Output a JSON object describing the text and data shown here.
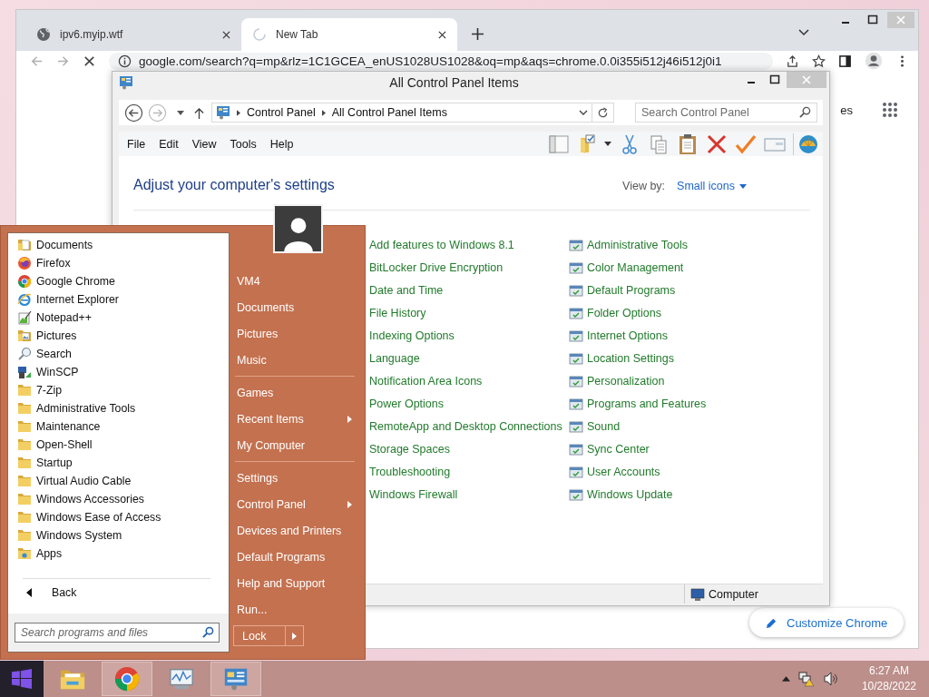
{
  "browser": {
    "tabs": [
      {
        "title": "ipv6.myip.wtf",
        "selected": false,
        "loading": false
      },
      {
        "title": "New Tab",
        "selected": true,
        "loading": true
      }
    ],
    "address": "google.com/search?q=mp&rlz=1C1GCEA_enUS1028US1028&oq=mp&aqs=chrome.0.0i355i512j46i512j0i1",
    "page_text": "es",
    "customize_button": "Customize Chrome"
  },
  "control_panel": {
    "title": "All Control Panel Items",
    "breadcrumb": [
      "Control Panel",
      "All Control Panel Items"
    ],
    "search_placeholder": "Search Control Panel",
    "menu": [
      "File",
      "Edit",
      "View",
      "Tools",
      "Help"
    ],
    "heading": "Adjust your computer's settings",
    "view_by_label": "View by:",
    "view_by_value": "Small icons",
    "left_items": [
      "Add features to Windows 8.1",
      "BitLocker Drive Encryption",
      "Date and Time",
      "File History",
      "Indexing Options",
      "Language",
      "Notification Area Icons",
      "Power Options",
      "RemoteApp and Desktop Connections",
      "Storage Spaces",
      "Troubleshooting",
      "Windows Firewall"
    ],
    "right_items": [
      "Administrative Tools",
      "Color Management",
      "Default Programs",
      "Folder Options",
      "Internet Options",
      "Location Settings",
      "Personalization",
      "Programs and Features",
      "Sound",
      "Sync Center",
      "User Accounts",
      "Windows Update"
    ],
    "status": "Computer"
  },
  "start_menu": {
    "programs": [
      {
        "label": "Documents",
        "kind": "documents"
      },
      {
        "label": "Firefox",
        "kind": "firefox"
      },
      {
        "label": "Google Chrome",
        "kind": "chrome"
      },
      {
        "label": "Internet Explorer",
        "kind": "ie"
      },
      {
        "label": "Notepad++",
        "kind": "notepad"
      },
      {
        "label": "Pictures",
        "kind": "pictures"
      },
      {
        "label": "Search",
        "kind": "search"
      },
      {
        "label": "WinSCP",
        "kind": "winscp"
      },
      {
        "label": "7-Zip",
        "kind": "folder"
      },
      {
        "label": "Administrative Tools",
        "kind": "folder"
      },
      {
        "label": "Maintenance",
        "kind": "folder"
      },
      {
        "label": "Open-Shell",
        "kind": "folder"
      },
      {
        "label": "Startup",
        "kind": "folder"
      },
      {
        "label": "Virtual Audio Cable",
        "kind": "folder"
      },
      {
        "label": "Windows Accessories",
        "kind": "folder"
      },
      {
        "label": "Windows Ease of Access",
        "kind": "folder"
      },
      {
        "label": "Windows System",
        "kind": "folder"
      },
      {
        "label": "Apps",
        "kind": "apps"
      }
    ],
    "back": "Back",
    "search_placeholder": "Search programs and files",
    "place_groups": [
      [
        {
          "label": "VM4",
          "submenu": false
        },
        {
          "label": "Documents",
          "submenu": false
        },
        {
          "label": "Pictures",
          "submenu": false
        },
        {
          "label": "Music",
          "submenu": false
        }
      ],
      [
        {
          "label": "Games",
          "submenu": false
        },
        {
          "label": "Recent Items",
          "submenu": true
        },
        {
          "label": "My Computer",
          "submenu": false
        }
      ],
      [
        {
          "label": "Settings",
          "submenu": false
        },
        {
          "label": "Control Panel",
          "submenu": true
        },
        {
          "label": "Devices and Printers",
          "submenu": false
        },
        {
          "label": "Default Programs",
          "submenu": false
        },
        {
          "label": "Help and Support",
          "submenu": false
        },
        {
          "label": "Run...",
          "submenu": false
        }
      ]
    ],
    "lock": "Lock"
  },
  "taskbar": {
    "apps": [
      {
        "kind": "explorer",
        "active": false
      },
      {
        "kind": "chrome",
        "active": true
      },
      {
        "kind": "monitor",
        "active": false
      },
      {
        "kind": "control-panel",
        "active": true
      }
    ],
    "time": "6:27 AM",
    "date": "10/28/2022"
  }
}
